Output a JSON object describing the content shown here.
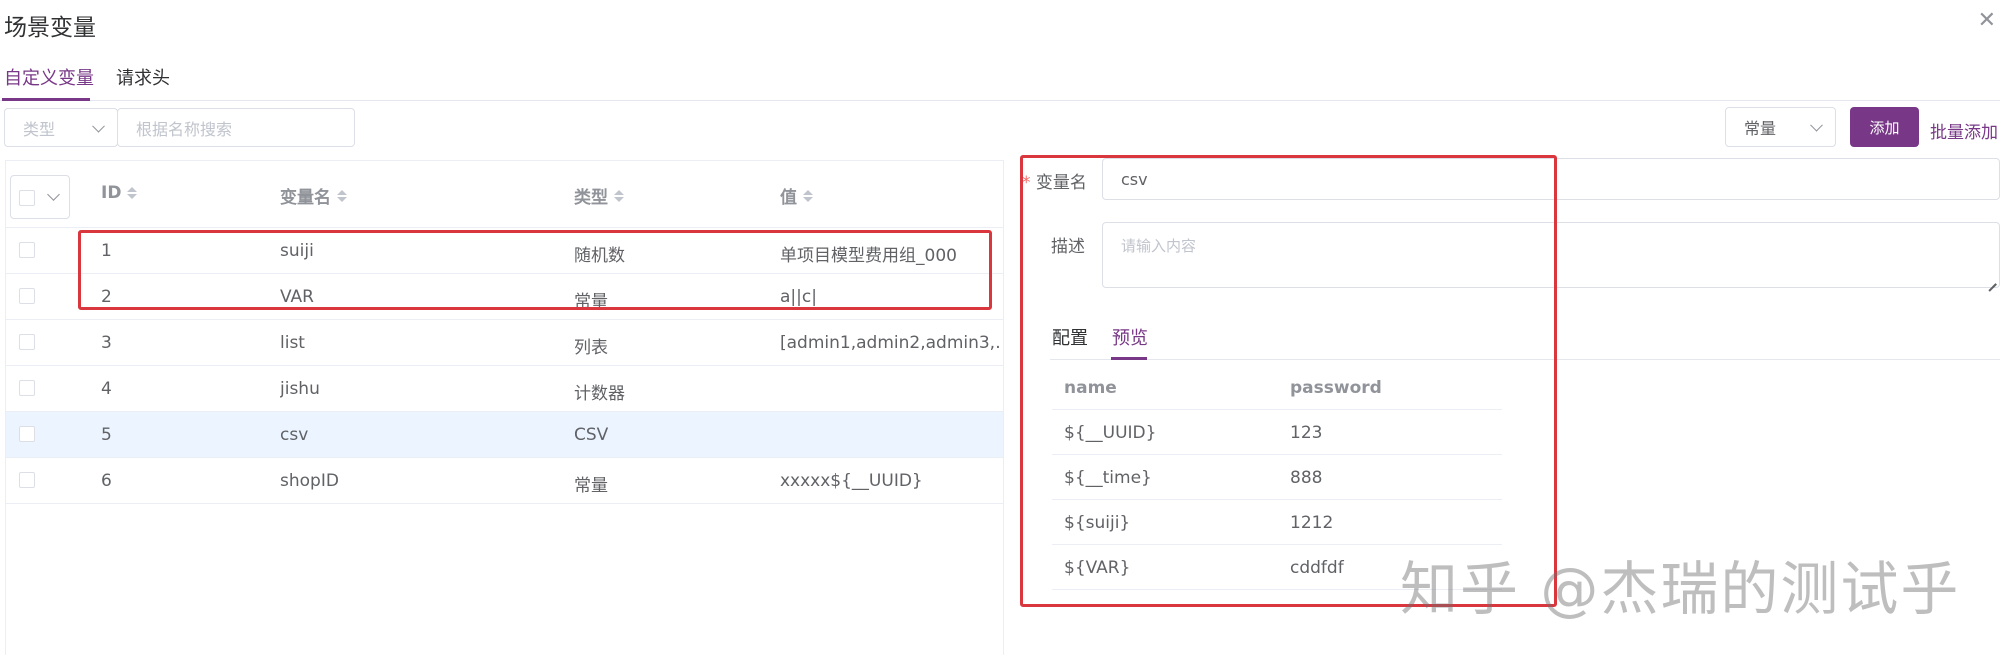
{
  "dialog": {
    "title": "场景变量",
    "close_icon": "close-icon"
  },
  "tabs": [
    {
      "label": "自定义变量",
      "active": true
    },
    {
      "label": "请求头",
      "active": false
    }
  ],
  "toolbar": {
    "type_placeholder": "类型",
    "search_placeholder": "根据名称搜索",
    "type_select_value": "常量",
    "add_label": "添加",
    "batch_add_label": "批量添加"
  },
  "table": {
    "headers": {
      "id": "ID",
      "name": "变量名",
      "type": "类型",
      "value": "值"
    },
    "rows": [
      {
        "id": "1",
        "name": "suiji",
        "type": "随机数",
        "value": "单项目模型费用组_000"
      },
      {
        "id": "2",
        "name": "VAR",
        "type": "常量",
        "value": "a||c|"
      },
      {
        "id": "3",
        "name": "list",
        "type": "列表",
        "value": "[admin1,admin2,admin3,…"
      },
      {
        "id": "4",
        "name": "jishu",
        "type": "计数器",
        "value": ""
      },
      {
        "id": "5",
        "name": "csv",
        "type": "CSV",
        "value": ""
      },
      {
        "id": "6",
        "name": "shopID",
        "type": "常量",
        "value": "xxxxx${__UUID}"
      }
    ]
  },
  "detail": {
    "name_label": "变量名",
    "required_mark": "*",
    "name_value": "csv",
    "desc_label": "描述",
    "desc_placeholder": "请输入内容",
    "subtabs": [
      {
        "label": "配置",
        "active": false
      },
      {
        "label": "预览",
        "active": true
      }
    ],
    "preview": {
      "headers": [
        "name",
        "password"
      ],
      "rows": [
        [
          "${__UUID}",
          "123"
        ],
        [
          "${__time}",
          "888"
        ],
        [
          "${suiji}",
          "1212"
        ],
        [
          "${VAR}",
          "cddfdf"
        ]
      ]
    }
  },
  "watermark": "知乎 @杰瑞的测试乎",
  "colors": {
    "accent": "#783887",
    "highlight_row": "#ecf5ff",
    "annotation_red": "#d9363e"
  }
}
